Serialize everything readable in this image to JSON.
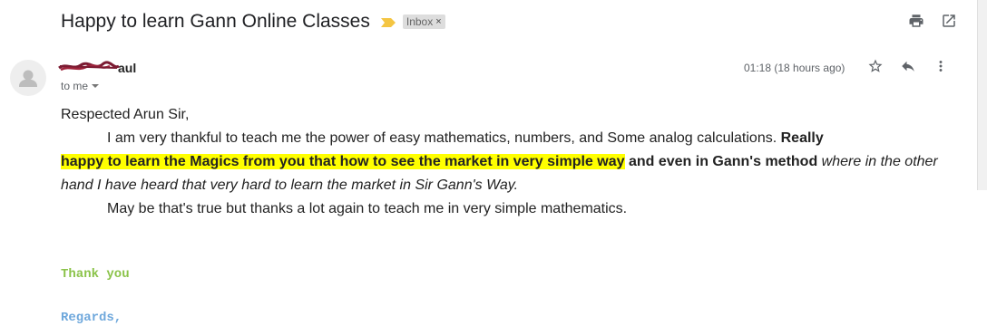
{
  "email": {
    "subject": "Happy to learn Gann Online Classes",
    "label": "Inbox",
    "label_remove": "×",
    "sender_name_suffix": "aul",
    "recipient_label": "to me",
    "timestamp": "01:18 (18 hours ago)",
    "greeting": "Respected Arun Sir,",
    "para1_normal": "I am very thankful to teach me the power of easy mathematics, numbers, and Some analog calculations. ",
    "para1_bold_a": "Really",
    "para1_bold_highlight": "happy to learn the Magics from you that how to see the market in very simple way",
    "para1_bold_b": " and even in Gann's method",
    "para1_italic": " where in the other hand I have heard that very hard to learn the market in Sir Gann's Way.",
    "para2": "May be that's true but thanks a lot again to teach me in very simple mathematics.",
    "signoff_thanks": "Thank you",
    "signoff_regards": "Regards,"
  },
  "icons": {
    "importance": "importance-marker-icon",
    "print": "print-icon",
    "new_window": "open-in-new-window-icon",
    "avatar": "default-avatar-icon",
    "star": "star-icon",
    "reply": "reply-icon",
    "more": "more-vert-icon"
  },
  "colors": {
    "importance": "#f4c542",
    "highlight": "#ffff00",
    "signature_thanks": "#8bc34a",
    "signature_regards": "#6fa8dc"
  }
}
